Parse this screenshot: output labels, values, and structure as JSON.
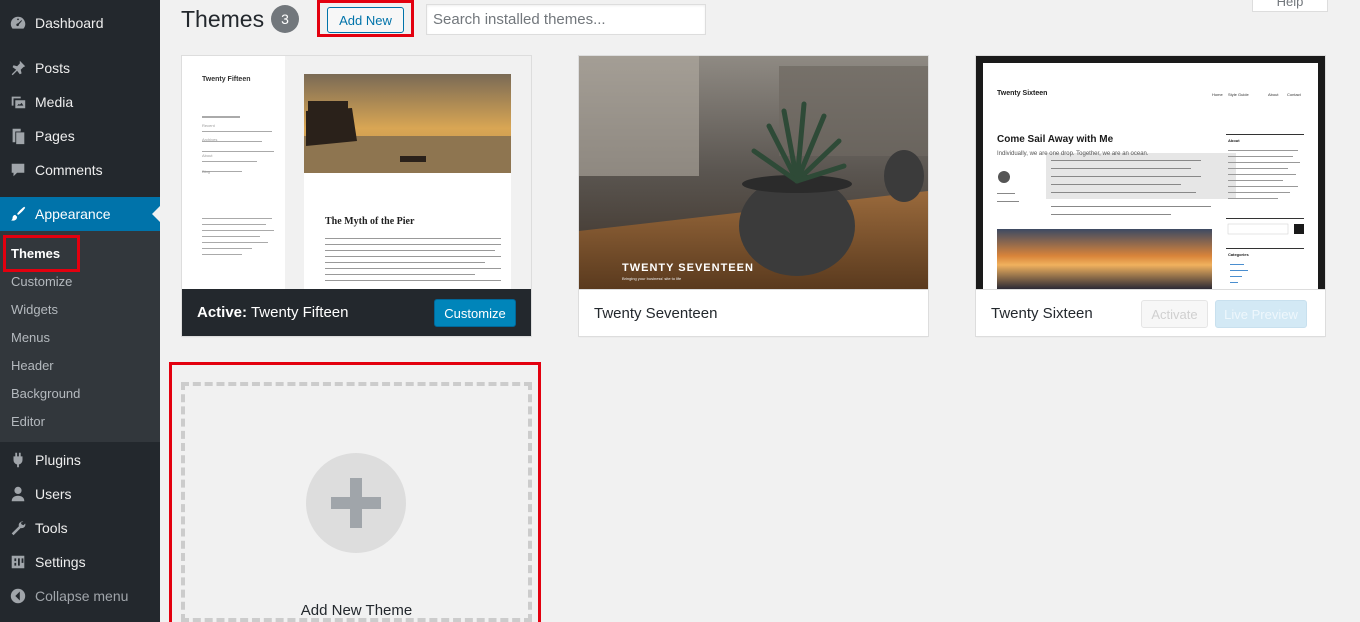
{
  "sidebar": {
    "dashboard": "Dashboard",
    "posts": "Posts",
    "media": "Media",
    "pages": "Pages",
    "comments": "Comments",
    "appearance": "Appearance",
    "submenu": {
      "themes": "Themes",
      "customize": "Customize",
      "widgets": "Widgets",
      "menus": "Menus",
      "header": "Header",
      "background": "Background",
      "editor": "Editor"
    },
    "plugins": "Plugins",
    "users": "Users",
    "tools": "Tools",
    "settings": "Settings",
    "collapse": "Collapse menu"
  },
  "header": {
    "title": "Themes",
    "count": "3",
    "add_new": "Add New",
    "search_placeholder": "Search installed themes...",
    "help": "Help"
  },
  "themes": [
    {
      "name": "Twenty Fifteen",
      "active_prefix": "Active:",
      "action": "Customize",
      "preview": {
        "site_title": "Twenty Fifteen",
        "post_title": "The Myth of the Pier",
        "widget_headings": [
          "Recent",
          "Archives",
          "About",
          "Blog"
        ]
      }
    },
    {
      "name": "Twenty Seventeen",
      "preview": {
        "site_title": "TWENTY SEVENTEEN",
        "tagline": "Bringing your business' site to life"
      }
    },
    {
      "name": "Twenty Sixteen",
      "actions": [
        "Activate",
        "Live Preview"
      ],
      "preview": {
        "site_title": "Twenty Sixteen",
        "nav": [
          "Home",
          "Style Guide",
          "About",
          "Contact"
        ],
        "post_title": "Come Sail Away with Me",
        "post_intro": "Individually, we are one drop. Together, we are an ocean.",
        "widget_headings": [
          "About",
          "Categories"
        ]
      }
    }
  ],
  "add_theme": {
    "label": "Add New Theme"
  },
  "colors": {
    "sidebar_bg": "#23282d",
    "accent": "#0073aa",
    "highlight_box": "#e3000f"
  }
}
